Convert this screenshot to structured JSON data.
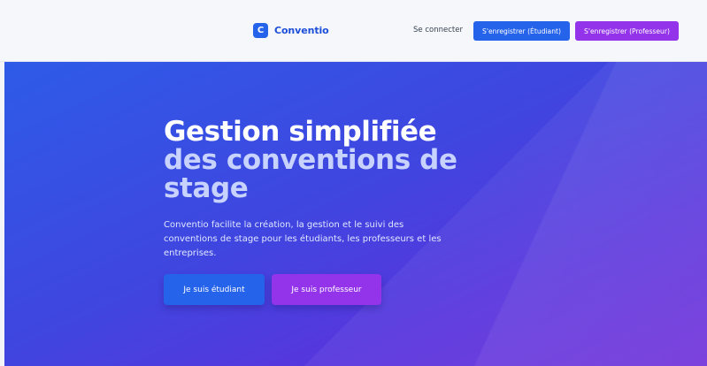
{
  "header": {
    "logo_letter": "C",
    "brand": "Conventio",
    "login_link": "Se connecter",
    "register_student": "S'enregistrer (Étudiant)",
    "register_professor": "S'enregistrer (Professeur)"
  },
  "hero": {
    "title_line1": "Gestion simplifiée",
    "title_line2": "des conventions de stage",
    "description": "Conventio facilite la création, la gestion et le suivi des conventions de stage pour les étudiants, les professeurs et les entreprises.",
    "student_button": "Je suis étudiant",
    "professor_button": "Je suis professeur"
  },
  "colors": {
    "primary_blue": "#2563eb",
    "accent_purple": "#9333ea",
    "title_light": "#c7d2fe"
  }
}
